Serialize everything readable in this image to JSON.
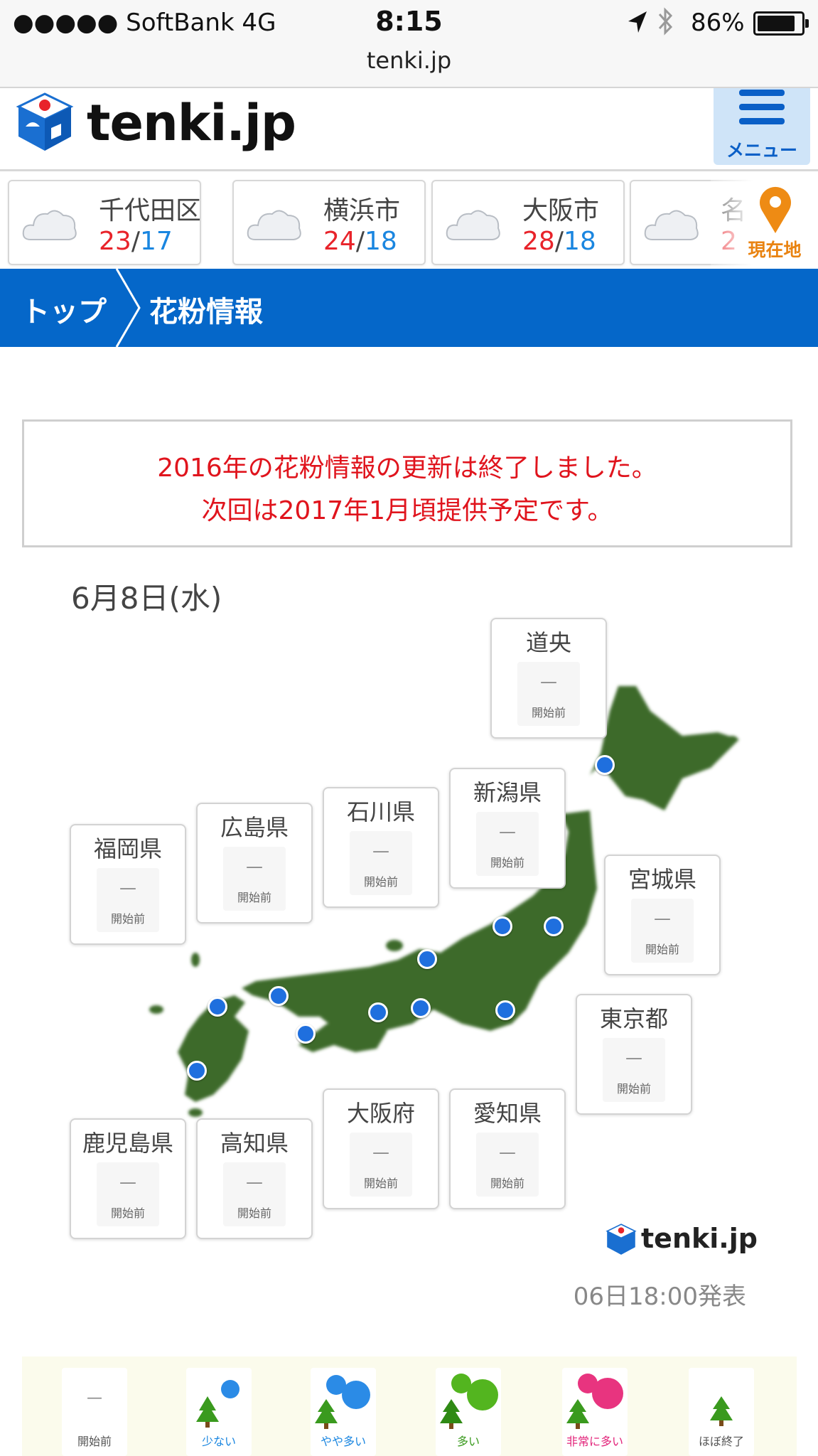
{
  "status_bar": {
    "carrier": "●●●●● SoftBank 4G",
    "time": "8:15",
    "battery": "86%",
    "url": "tenki.jp"
  },
  "header": {
    "logo": "tenki.jp",
    "menu_label": "メニュー"
  },
  "cities": [
    {
      "name": "千代田区",
      "high": "23",
      "low": "17"
    },
    {
      "name": "横浜市",
      "high": "24",
      "low": "18"
    },
    {
      "name": "大阪市",
      "high": "28",
      "low": "18"
    },
    {
      "name": "名",
      "high": "2",
      "low": ""
    }
  ],
  "location_button": "現在地",
  "breadcrumb": {
    "top": "トップ",
    "current": "花粉情報"
  },
  "notice": {
    "line1": "2016年の花粉情報の更新は終了しました。",
    "line2": "次回は2017年1月頃提供予定です。"
  },
  "date": "6月8日(水)",
  "regions": [
    {
      "name": "道央",
      "value": "—",
      "status": "開始前"
    },
    {
      "name": "新潟県",
      "value": "—",
      "status": "開始前"
    },
    {
      "name": "石川県",
      "value": "—",
      "status": "開始前"
    },
    {
      "name": "広島県",
      "value": "—",
      "status": "開始前"
    },
    {
      "name": "福岡県",
      "value": "—",
      "status": "開始前"
    },
    {
      "name": "宮城県",
      "value": "—",
      "status": "開始前"
    },
    {
      "name": "東京都",
      "value": "—",
      "status": "開始前"
    },
    {
      "name": "大阪府",
      "value": "—",
      "status": "開始前"
    },
    {
      "name": "愛知県",
      "value": "—",
      "status": "開始前"
    },
    {
      "name": "鹿児島県",
      "value": "—",
      "status": "開始前"
    },
    {
      "name": "高知県",
      "value": "—",
      "status": "開始前"
    }
  ],
  "watermark": "tenki.jp",
  "issued": "06日18:00発表",
  "legend": [
    {
      "label": "開始前",
      "value": "—",
      "color": "#555555"
    },
    {
      "label": "少ない",
      "color": "#1a86e0"
    },
    {
      "label": "やや多い",
      "color": "#1a86e0"
    },
    {
      "label": "多い",
      "color": "#3a9a1e"
    },
    {
      "label": "非常に多い",
      "color": "#e2237a"
    },
    {
      "label": "ほぼ終了",
      "color": "#555555"
    }
  ],
  "colors": {
    "brand_blue": "#0567c9",
    "high_temp": "#e8232a",
    "low_temp": "#1a86e0",
    "notice_red": "#e0141d",
    "location_orange": "#e98311"
  }
}
